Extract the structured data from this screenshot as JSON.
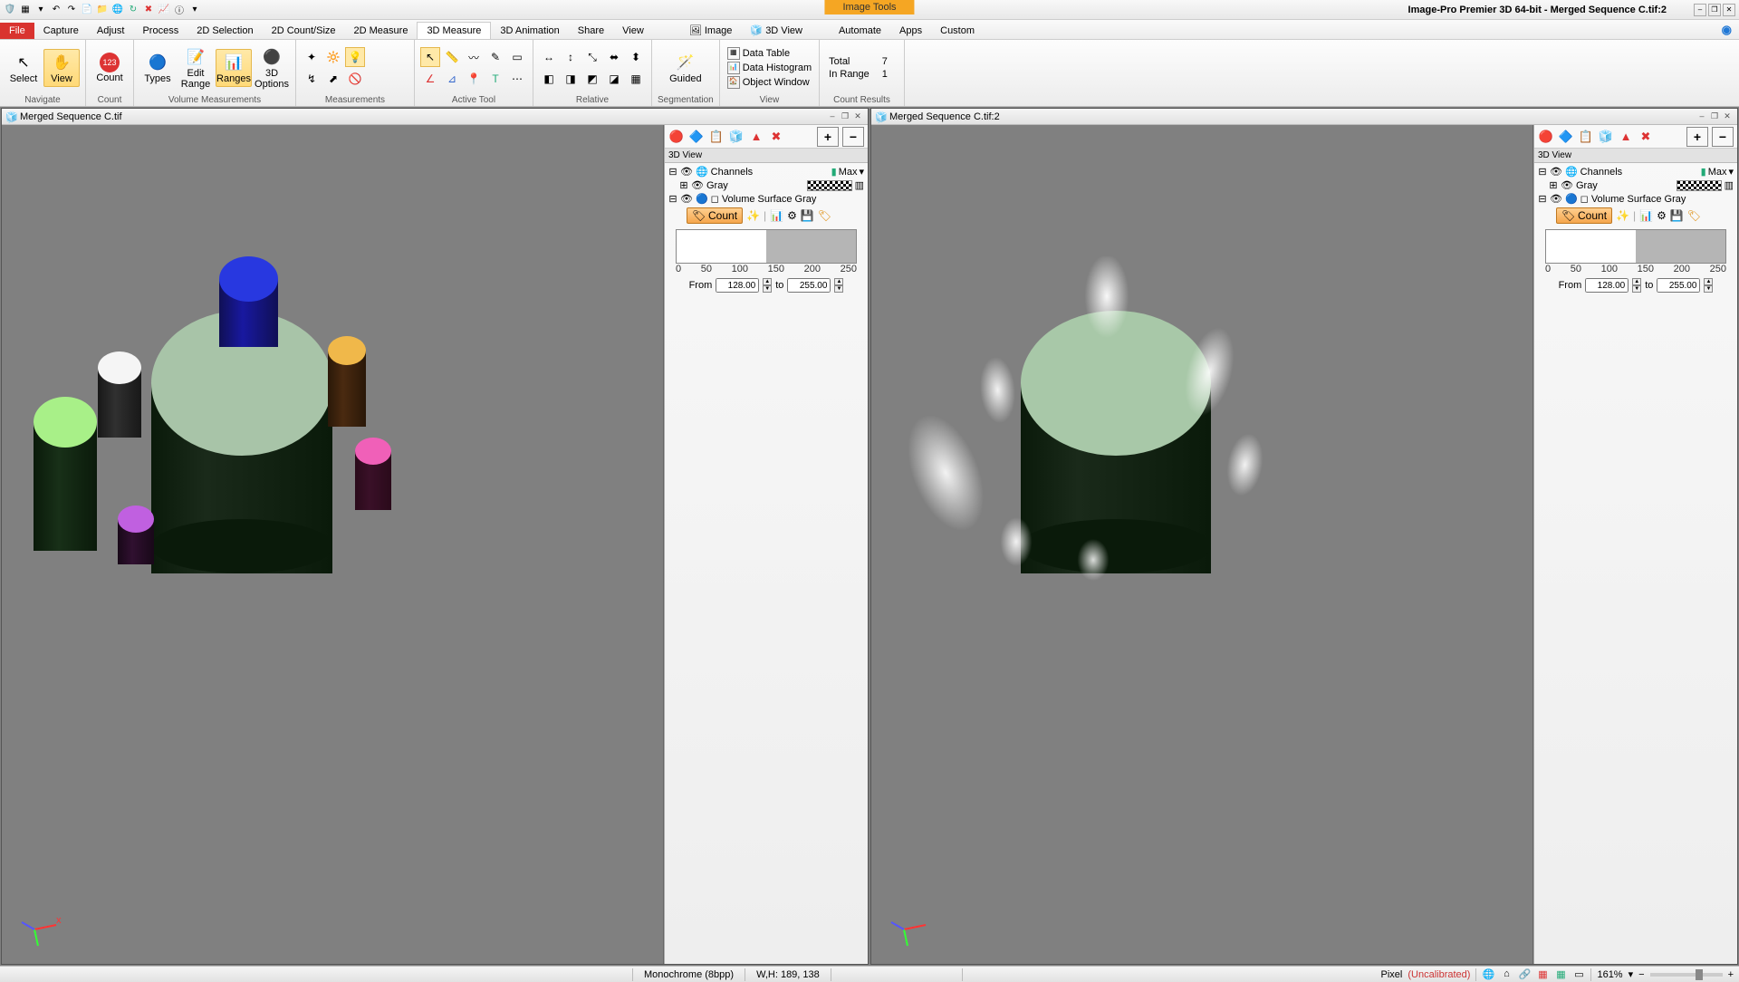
{
  "title_bar": {
    "image_tools": "Image Tools",
    "app_title": "Image-Pro Premier 3D 64-bit - Merged Sequence C.tif:2"
  },
  "tabs": {
    "file": "File",
    "items": [
      "Capture",
      "Adjust",
      "Process",
      "2D Selection",
      "2D Count/Size",
      "2D Measure",
      "3D Measure",
      "3D Animation",
      "Share",
      "View"
    ],
    "active": "3D Measure",
    "contextual": [
      {
        "icon": "🖼",
        "label": "Image"
      },
      {
        "icon": "🧊",
        "label": "3D View"
      }
    ],
    "right_items": [
      "Automate",
      "Apps",
      "Custom"
    ]
  },
  "ribbon": {
    "navigate": {
      "select": "Select",
      "view": "View",
      "label": "Navigate"
    },
    "count": {
      "count": "Count",
      "label": "Count"
    },
    "volmeas": {
      "types": "Types",
      "edit_range": "Edit\nRange",
      "ranges": "Ranges",
      "options": "3D Options",
      "label": "Volume Measurements"
    },
    "measurements": {
      "label": "Measurements"
    },
    "activetool": {
      "label": "Active Tool"
    },
    "relative": {
      "label": "Relative"
    },
    "segmentation": {
      "guided": "Guided",
      "label": "Segmentation"
    },
    "view_grp": {
      "items": [
        "Data Table",
        "Data Histogram",
        "Object Window"
      ],
      "label": "View"
    },
    "results": {
      "total_label": "Total",
      "total_val": "7",
      "inrange_label": "In Range",
      "inrange_val": "1",
      "label": "Count Results"
    }
  },
  "docs": [
    {
      "title": "Merged Sequence C.tif"
    },
    {
      "title": "Merged Sequence C.tif:2"
    }
  ],
  "panel": {
    "header": "3D View",
    "channels": "Channels",
    "max": "Max",
    "gray": "Gray",
    "vol_surf": "Volume Surface Gray",
    "count": "Count",
    "ticks": [
      "0",
      "50",
      "100",
      "150",
      "200",
      "250"
    ],
    "from_label": "From",
    "from_val": "128.00",
    "to_label": "to",
    "to_val": "255.00"
  },
  "status": {
    "mono": "Monochrome (8bpp)",
    "wh": "W,H: 189, 138",
    "pixel": "Pixel",
    "uncal": "(Uncalibrated)",
    "zoom": "161%"
  }
}
